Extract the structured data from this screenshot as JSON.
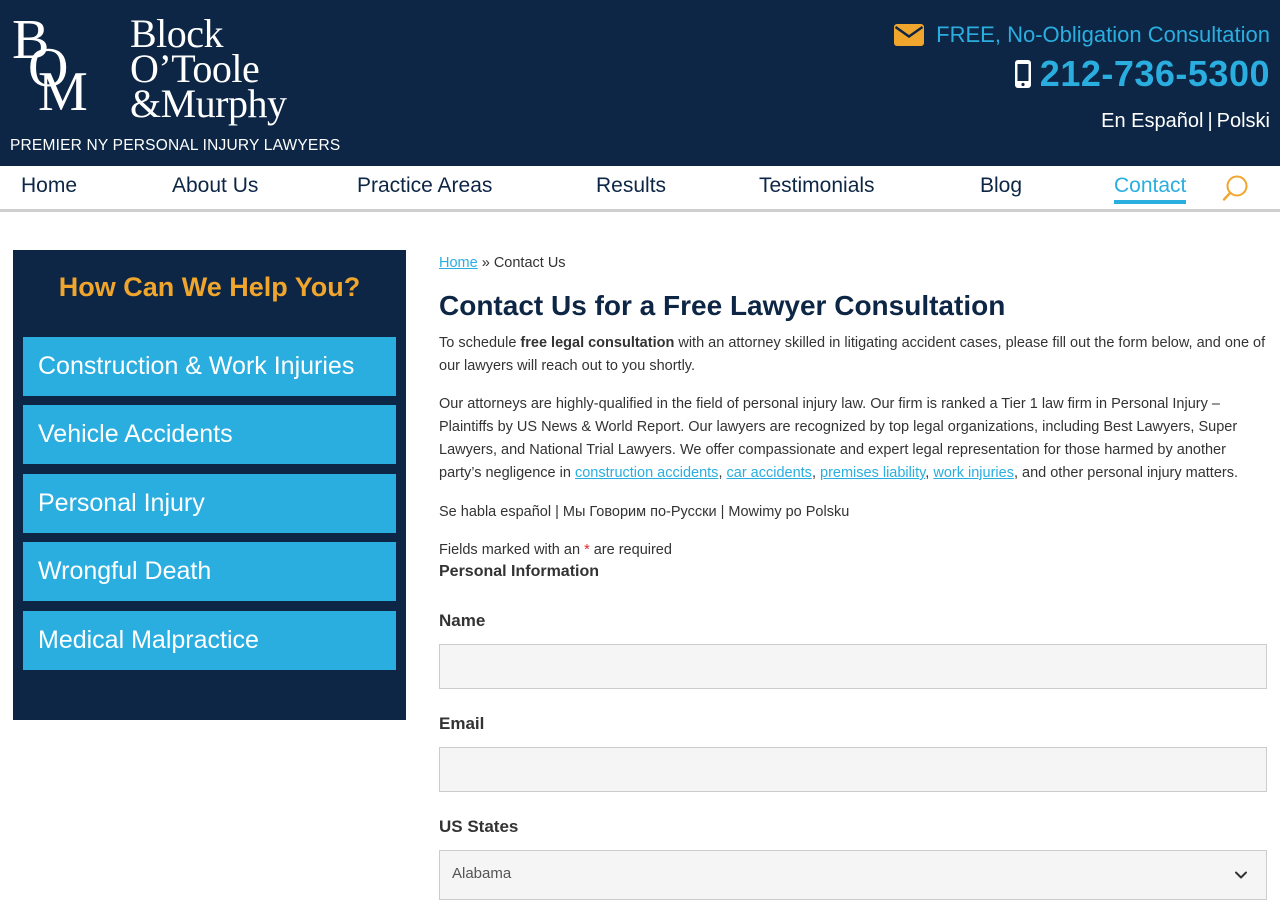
{
  "header": {
    "logo": {
      "monogram": [
        "B",
        "O",
        "M"
      ],
      "name_lines": [
        "Block",
        "O’Toole",
        "&Murphy"
      ]
    },
    "tagline": "PREMIER NY PERSONAL INJURY LAWYERS",
    "consultation_text": "FREE, No-Obligation Consultation",
    "consultation_icon": "envelope-icon",
    "phone": "212-736-5300",
    "phone_icon": "mobile-phone-icon",
    "languages": {
      "spanish": "En Español",
      "separator": "|",
      "polish": "Polski"
    }
  },
  "nav": {
    "items": [
      {
        "label": "Home"
      },
      {
        "label": "About Us"
      },
      {
        "label": "Practice Areas"
      },
      {
        "label": "Results"
      },
      {
        "label": "Testimonials"
      },
      {
        "label": "Blog"
      },
      {
        "label": "Contact"
      }
    ],
    "active": "Contact",
    "search_icon": "search-icon"
  },
  "sidebar": {
    "title": "How Can We Help You?",
    "buttons": [
      {
        "label": "Construction & Work Injuries"
      },
      {
        "label": "Vehicle Accidents"
      },
      {
        "label": "Personal Injury"
      },
      {
        "label": "Wrongful Death"
      },
      {
        "label": "Medical Malpractice"
      }
    ]
  },
  "main": {
    "breadcrumb": {
      "home": "Home",
      "separator": "»",
      "current": "Contact Us"
    },
    "title": "Contact Us for a Free Lawyer Consultation",
    "intro": {
      "prefix": "To schedule ",
      "bold": "free legal consultation",
      "suffix": " with an attorney skilled in litigating accident cases, please fill out the form below, and one of our lawyers will reach out to you shortly."
    },
    "about": {
      "text": "Our attorneys are highly-qualified in the field of personal injury law. Our firm is ranked a Tier 1 law firm in Personal Injury – Plaintiffs by US News & World Report. Our lawyers are recognized by top legal organizations, including Best Lawyers, Super Lawyers, and National Trial Lawyers. We offer compassionate and expert legal representation for those harmed by another party’s negligence in ",
      "links": [
        "construction accidents",
        "car accidents",
        "premises liability",
        "work injuries"
      ],
      "comma": ", ",
      "suffix": ", and other personal injury matters."
    },
    "languages_line": "Se habla español | Мы Говорим по-Русски | Mowimy po Polsku",
    "required_note": {
      "prefix": "Fields marked with an ",
      "star": "*",
      "suffix": " are required"
    },
    "form": {
      "section_title": "Personal Information",
      "name_label": "Name",
      "name_value": "",
      "email_label": "Email",
      "email_value": "",
      "state_label": "US States",
      "state_value": "Alabama"
    }
  },
  "colors": {
    "navy": "#0d2645",
    "accent_blue": "#2aaee0",
    "gold": "#f0a52c"
  }
}
